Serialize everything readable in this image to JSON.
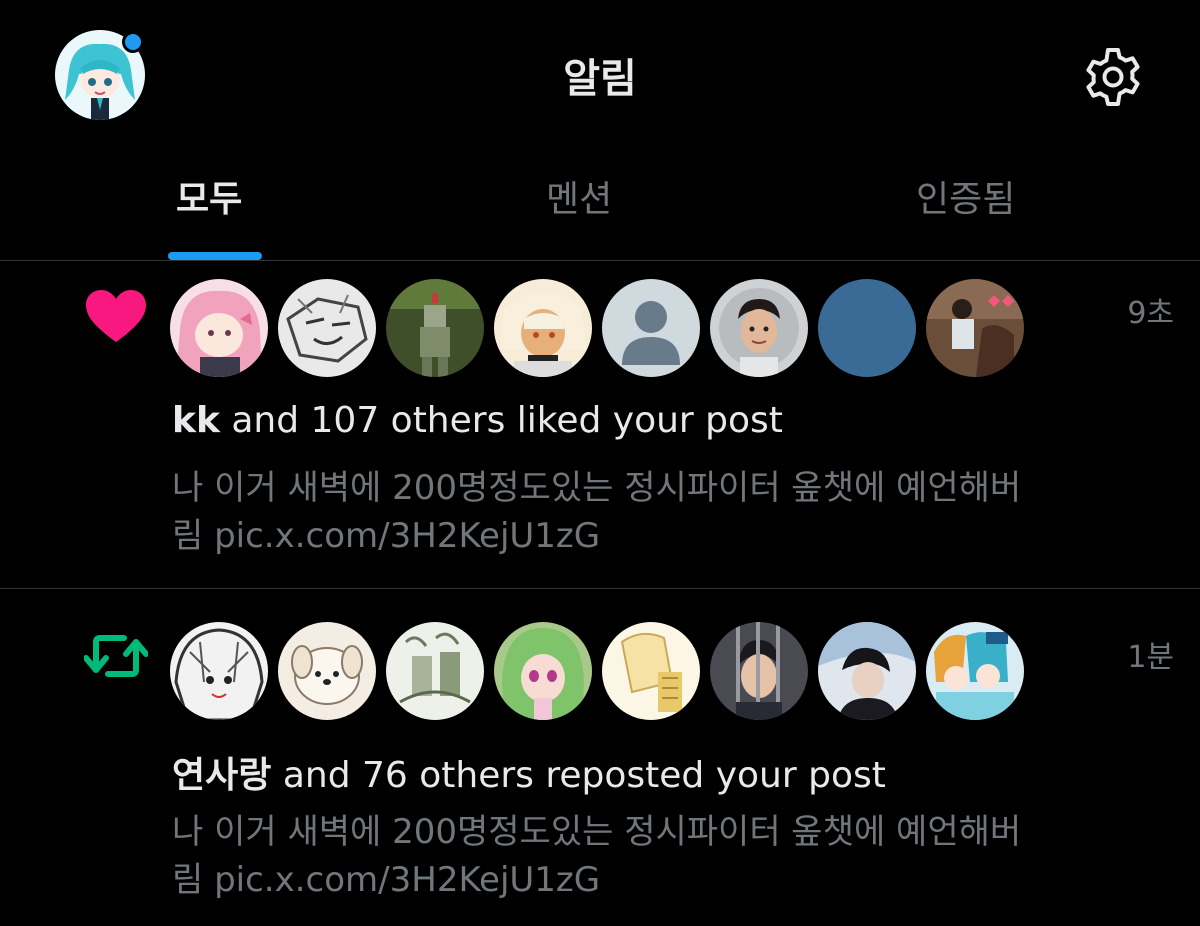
{
  "header": {
    "title": "알림"
  },
  "tabs": [
    {
      "label": "모두",
      "active": true
    },
    {
      "label": "멘션",
      "active": false
    },
    {
      "label": "인증됨",
      "active": false
    }
  ],
  "notifications": [
    {
      "type": "like",
      "icon": "heart-icon",
      "icon_color": "#f91880",
      "time": "9초",
      "actor": "kk",
      "action_text": " and 107 others liked your post",
      "preview_line1": "나 이거 새벽에 200명정도있는 정시파이터 옾챗에 예언해버",
      "preview_line2": "림 pic.x.com/3H2KejU1zG"
    },
    {
      "type": "repost",
      "icon": "repost-icon",
      "icon_color": "#00ba7c",
      "time": "1분",
      "actor": "연사랑",
      "action_text": " and 76 others reposted your post",
      "preview_line1": "나 이거 새벽에 200명정도있는 정시파이터 옾챗에 예언해버",
      "preview_line2": "림 pic.x.com/3H2KejU1zG"
    }
  ],
  "colors": {
    "accent": "#1d9bf0",
    "background": "#000000",
    "primary_text": "#e7e9ea",
    "secondary_text": "#71767b",
    "like": "#f91880",
    "repost": "#00ba7c"
  }
}
